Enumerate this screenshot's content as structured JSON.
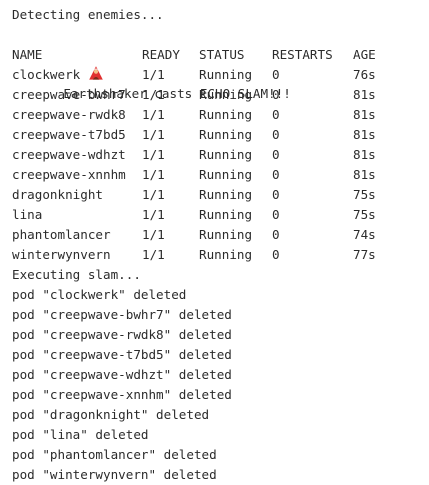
{
  "terminal": {
    "line_detecting": "Detecting enemies...",
    "line_cast": "Earthshaker casts ECHO SLAM!!!",
    "cast_icon": "earthshaker-icon",
    "table": {
      "headers": {
        "name": "NAME",
        "ready": "READY",
        "status": "STATUS",
        "restarts": "RESTARTS",
        "age": "AGE"
      },
      "rows": [
        {
          "name": "clockwerk",
          "ready": "1/1",
          "status": "Running",
          "restarts": "0",
          "age": "76s"
        },
        {
          "name": "creepwave-bwhr7",
          "ready": "1/1",
          "status": "Running",
          "restarts": "0",
          "age": "81s"
        },
        {
          "name": "creepwave-rwdk8",
          "ready": "1/1",
          "status": "Running",
          "restarts": "0",
          "age": "81s"
        },
        {
          "name": "creepwave-t7bd5",
          "ready": "1/1",
          "status": "Running",
          "restarts": "0",
          "age": "81s"
        },
        {
          "name": "creepwave-wdhzt",
          "ready": "1/1",
          "status": "Running",
          "restarts": "0",
          "age": "81s"
        },
        {
          "name": "creepwave-xnnhm",
          "ready": "1/1",
          "status": "Running",
          "restarts": "0",
          "age": "81s"
        },
        {
          "name": "dragonknight",
          "ready": "1/1",
          "status": "Running",
          "restarts": "0",
          "age": "75s"
        },
        {
          "name": "lina",
          "ready": "1/1",
          "status": "Running",
          "restarts": "0",
          "age": "75s"
        },
        {
          "name": "phantomlancer",
          "ready": "1/1",
          "status": "Running",
          "restarts": "0",
          "age": "74s"
        },
        {
          "name": "winterwynvern",
          "ready": "1/1",
          "status": "Running",
          "restarts": "0",
          "age": "77s"
        }
      ]
    },
    "line_executing": "Executing slam...",
    "deleted_lines": [
      "pod \"clockwerk\" deleted",
      "pod \"creepwave-bwhr7\" deleted",
      "pod \"creepwave-rwdk8\" deleted",
      "pod \"creepwave-t7bd5\" deleted",
      "pod \"creepwave-wdhzt\" deleted",
      "pod \"creepwave-xnnhm\" deleted",
      "pod \"dragonknight\" deleted",
      "pod \"lina\" deleted",
      "pod \"phantomlancer\" deleted",
      "pod \"winterwynvern\" deleted"
    ]
  },
  "colors": {
    "background": "#ffffff",
    "text": "#2b2b2b",
    "icon_red": "#e03030",
    "icon_skin": "#f4c28a"
  }
}
